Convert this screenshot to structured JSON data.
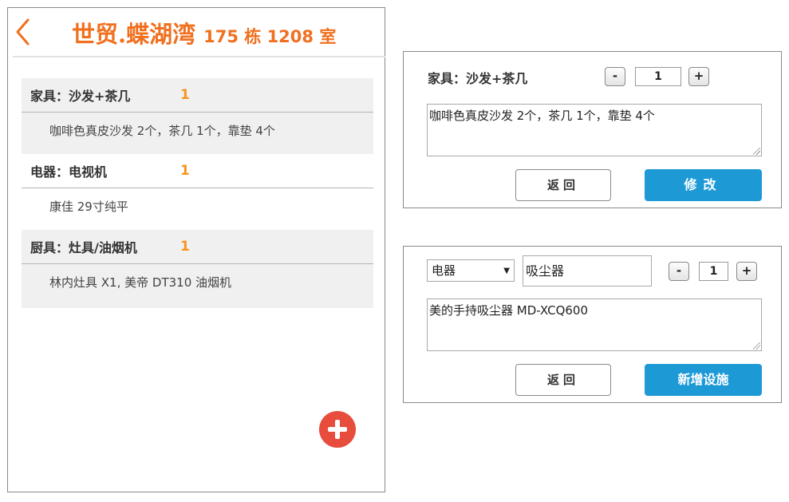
{
  "header": {
    "estate_name": "世贸.蝶湖湾",
    "room": "175 栋 1208 室"
  },
  "facilities": [
    {
      "name": "家具：沙发+茶几",
      "qty": "1",
      "desc": "咖啡色真皮沙发  2个，茶几 1个，靠垫 4个"
    },
    {
      "name": "电器：电视机",
      "qty": "1",
      "desc": "康佳 29寸纯平"
    },
    {
      "name": "厨具：灶具/油烟机",
      "qty": "1",
      "desc": "林内灶具  X1, 美帝 DT310 油烟机"
    }
  ],
  "edit_dialog": {
    "title": "家具：沙发+茶几",
    "minus_label": "-",
    "quantity": "1",
    "plus_label": "+",
    "description": "咖啡色真皮沙发  2个，茶几 1个，靠垫 4个",
    "back_label": "返回",
    "submit_label": "修改"
  },
  "add_dialog": {
    "category_selected": "电器",
    "item_name": "吸尘器",
    "minus_label": "-",
    "quantity": "1",
    "plus_label": "+",
    "description": "美的手持吸尘器 MD-XCQ600",
    "back_label": "返回",
    "submit_label": "新增设施"
  },
  "colors": {
    "accent_orange": "#f07020",
    "quantity_orange": "#f7941d",
    "primary_blue": "#1d9ad6",
    "fab_red": "#e74c3c"
  },
  "icons": {
    "back": "chevron-left-icon",
    "add": "plus-circle-icon",
    "dropdown": "triangle-down-icon"
  }
}
